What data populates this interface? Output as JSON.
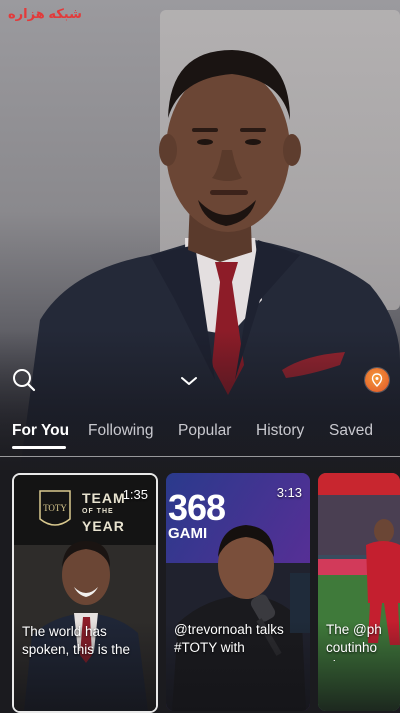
{
  "watermark": {
    "text": "شبکه هزاره"
  },
  "header": {
    "search_icon": "search-icon",
    "dropdown_icon": "chevron-down-icon",
    "profile_icon": "location-pin-icon"
  },
  "tabs": [
    {
      "label": "For You",
      "active": true
    },
    {
      "label": "Following",
      "active": false
    },
    {
      "label": "Popular",
      "active": false
    },
    {
      "label": "History",
      "active": false
    },
    {
      "label": "Saved",
      "active": false
    }
  ],
  "cards": [
    {
      "duration": "1:35",
      "badge": "TOTY",
      "title_line1": "TEAM",
      "title_small": "OF THE",
      "title_line2": "YEAR",
      "caption": "The world has spoken, this is the"
    },
    {
      "duration": "3:13",
      "thumb_text": "368",
      "thumb_sub": "GAMI",
      "caption": "@trevornoah talks #TOTY with"
    },
    {
      "caption": "The @ph coutinho shows"
    }
  ],
  "colors": {
    "accent": "#e0542a",
    "watermark": "#e33a3a",
    "active_tab": "#ffffff",
    "inactive_tab": "#c9c9cf"
  }
}
